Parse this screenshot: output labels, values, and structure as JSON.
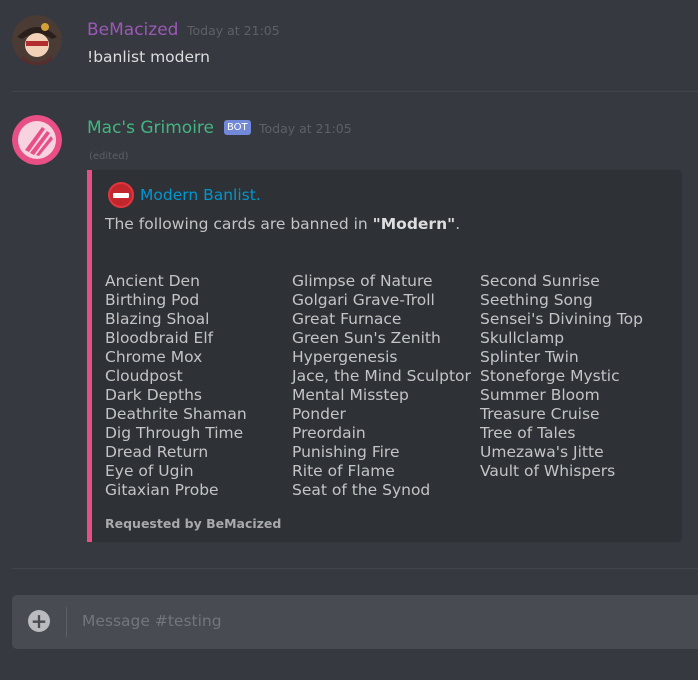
{
  "messages": [
    {
      "username": "BeMacized",
      "username_color": "#9b59b6",
      "timestamp": "Today at 21:05",
      "content": "!banlist modern"
    },
    {
      "username": "Mac's Grimoire",
      "username_color": "#43b581",
      "bot_tag": "BOT",
      "timestamp": "Today at 21:05",
      "edited": "(edited)",
      "embed": {
        "accent": "#e94f85",
        "title": "Modern Banlist.",
        "desc_prefix": "The following cards are banned in ",
        "desc_format": "\"Modern\"",
        "desc_suffix": ".",
        "columns": [
          [
            "Ancient Den",
            "Birthing Pod",
            "Blazing Shoal",
            "Bloodbraid Elf",
            "Chrome Mox",
            "Cloudpost",
            "Dark Depths",
            "Deathrite Shaman",
            "Dig Through Time",
            "Dread Return",
            "Eye of Ugin",
            "Gitaxian Probe"
          ],
          [
            "Glimpse of Nature",
            "Golgari Grave-Troll",
            "Great Furnace",
            "Green Sun's Zenith",
            "Hypergenesis",
            "Jace, the Mind Sculptor",
            "Mental Misstep",
            "Ponder",
            "Preordain",
            "Punishing Fire",
            "Rite of Flame",
            "Seat of the Synod"
          ],
          [
            "Second Sunrise",
            "Seething Song",
            "Sensei's Divining Top",
            "Skullclamp",
            "Splinter Twin",
            "Stoneforge Mystic",
            "Summer Bloom",
            "Treasure Cruise",
            "Tree of Tales",
            "Umezawa's Jitte",
            "Vault of Whispers"
          ]
        ],
        "footer": "Requested by BeMacized"
      }
    }
  ],
  "input": {
    "placeholder": "Message #testing",
    "plus_icon": "plus-circle-icon"
  },
  "colors": {
    "background": "#36393f",
    "embed_bg": "#2e3136",
    "input_bg": "#484b51"
  }
}
